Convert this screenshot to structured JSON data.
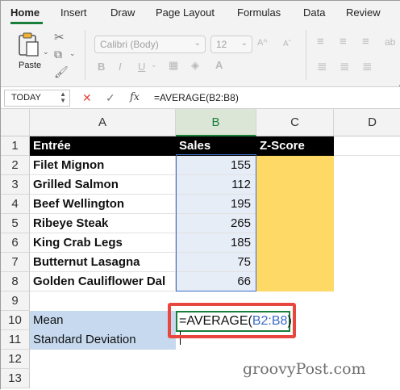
{
  "ribbon_tabs": [
    "Home",
    "Insert",
    "Draw",
    "Page Layout",
    "Formulas",
    "Data",
    "Review"
  ],
  "ribbon": {
    "paste_label": "Paste",
    "font_name": "Calibri (Body)",
    "font_size": "12",
    "bold": "B",
    "italic": "I",
    "underline": "U"
  },
  "formula_bar": {
    "name_box": "TODAY",
    "fx": "fx",
    "formula": "=AVERAGE(B2:B8)"
  },
  "columns": [
    "A",
    "B",
    "C",
    "D"
  ],
  "rows": [
    "1",
    "2",
    "3",
    "4",
    "5",
    "6",
    "7",
    "8",
    "9",
    "10",
    "11",
    "12",
    "13"
  ],
  "headers": {
    "a": "Entrée",
    "b": "Sales",
    "c": "Z-Score"
  },
  "entrees": [
    {
      "name": "Filet Mignon",
      "sales": "155"
    },
    {
      "name": "Grilled Salmon",
      "sales": "112"
    },
    {
      "name": "Beef Wellington",
      "sales": "195"
    },
    {
      "name": "Ribeye Steak",
      "sales": "265"
    },
    {
      "name": "King Crab Legs",
      "sales": "185"
    },
    {
      "name": "Butternut Lasagna",
      "sales": "75"
    },
    {
      "name": "Golden Cauliflower Dal",
      "sales": "66"
    }
  ],
  "stats": {
    "mean": "Mean",
    "std": "Standard Deviation"
  },
  "editing": {
    "prefix": "=AVERAGE(",
    "ref": "B2:B8",
    "suffix": ")"
  },
  "watermark": "groovyPost.com",
  "colors": {
    "accent": "#1a7f3b",
    "range_blue": "#3c6bc4",
    "zscore_fill": "#fed966",
    "label_fill": "#c6d9ee",
    "callout": "#e8473f"
  }
}
